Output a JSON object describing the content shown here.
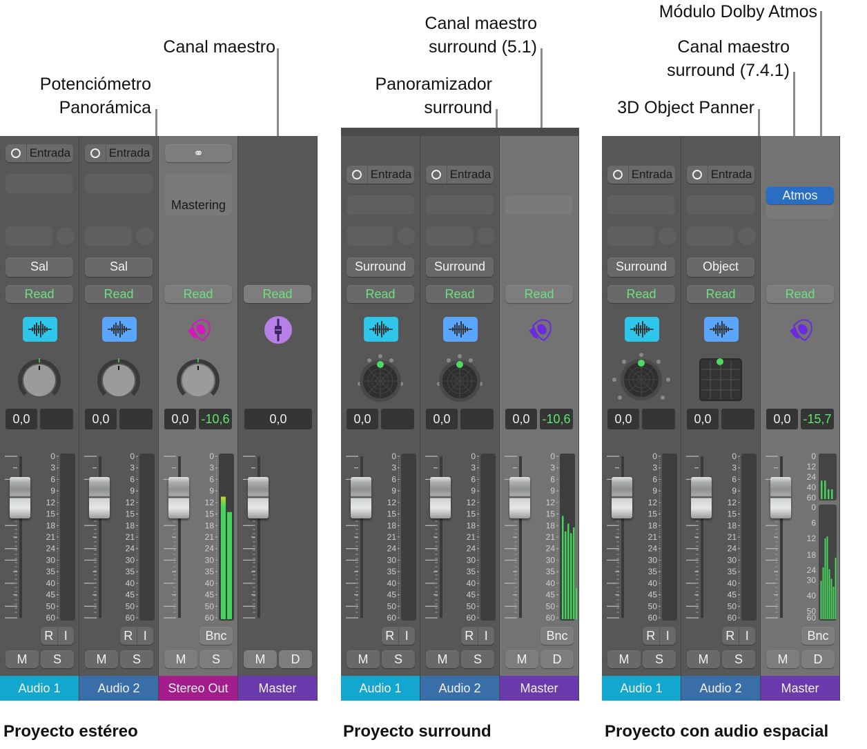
{
  "callouts": {
    "pan_knob": [
      "Potenciómetro",
      "Panorámica"
    ],
    "master_stereo": [
      "Canal maestro"
    ],
    "surround_master": [
      "Canal maestro",
      "surround (5.1)"
    ],
    "surround_panner": [
      "Panoramizador",
      "surround"
    ],
    "dolby_module": [
      "Módulo Dolby Atmos"
    ],
    "atmos_master": [
      "Canal maestro",
      "surround (7.4.1)"
    ],
    "object_panner": [
      "3D Object Panner"
    ]
  },
  "captions": {
    "stereo": "Proyecto estéreo",
    "surround": "Proyecto surround",
    "spatial": "Proyecto con audio espacial"
  },
  "colors": {
    "audio1": "#13a6cf",
    "audio2": "#3a6ea8",
    "stereo_out": "#a31c8c",
    "master": "#6a3aad",
    "read_green": "#6ee07e",
    "meter_green": "#44d45a",
    "atmos_blue": "#2a6ec4"
  },
  "common": {
    "input_label": "Entrada",
    "read_label": "Read",
    "mute_label": "M",
    "solo_label": "S",
    "dim_label": "D",
    "record_label": "R",
    "input_monitor_label": "I",
    "bounce_label": "Bnc",
    "mastering_label": "Mastering",
    "atmos_label": "Atmos"
  },
  "mixers": [
    {
      "id": "stereo",
      "strips": [
        {
          "name": "Audio 1",
          "type": "audio",
          "output": "Sal",
          "panner": "knob",
          "volume": "0,0",
          "peak": "",
          "meter": []
        },
        {
          "name": "Audio 2",
          "type": "audio",
          "output": "Sal",
          "panner": "knob",
          "volume": "0,0",
          "peak": "",
          "meter": []
        },
        {
          "name": "Stereo Out",
          "type": "output",
          "panner": "knob",
          "volume": "0,0",
          "peak": "-10,6",
          "meter": [
            10.5,
            14.5
          ]
        },
        {
          "name": "Master",
          "type": "master",
          "volume": "0,0"
        }
      ]
    },
    {
      "id": "surround",
      "strips": [
        {
          "name": "Audio 1",
          "type": "audio",
          "output": "Surround",
          "panner": "surround",
          "volume": "0,0",
          "peak": "",
          "meter": []
        },
        {
          "name": "Audio 2",
          "type": "audio",
          "output": "Surround",
          "panner": "surround",
          "volume": "0,0",
          "peak": "",
          "meter": []
        },
        {
          "name": "Master",
          "type": "surround-master",
          "volume": "0,0",
          "peak": "-10,6",
          "meter": [
            15.5,
            19.5,
            17.5,
            20,
            18.5,
            42
          ]
        }
      ]
    },
    {
      "id": "spatial",
      "strips": [
        {
          "name": "Audio 1",
          "type": "audio",
          "output": "Surround",
          "panner": "surround",
          "volume": "0,0",
          "peak": "",
          "meter": []
        },
        {
          "name": "Audio 2",
          "type": "audio",
          "output": "Object",
          "panner": "object",
          "volume": "0,0",
          "peak": "",
          "meter": []
        },
        {
          "name": "Master",
          "type": "atmos-master",
          "volume": "0,0",
          "peak": "-15,7",
          "meter_top": [
            28,
            28,
            42,
            42
          ],
          "meter": [
            38,
            31,
            16,
            15,
            32,
            37,
            41,
            26
          ]
        }
      ]
    }
  ],
  "scales": {
    "fader_meter": [
      "0",
      "3",
      "6",
      "9",
      "12",
      "15",
      "18",
      "21",
      "24",
      "30",
      "35",
      "40",
      "45",
      "50",
      "60"
    ],
    "atmos_top": [
      "0",
      "12",
      "24",
      "40",
      "60"
    ],
    "atmos_bottom": [
      "0",
      "6",
      "12",
      "18",
      "24",
      "30",
      "40",
      "50",
      "60"
    ]
  }
}
